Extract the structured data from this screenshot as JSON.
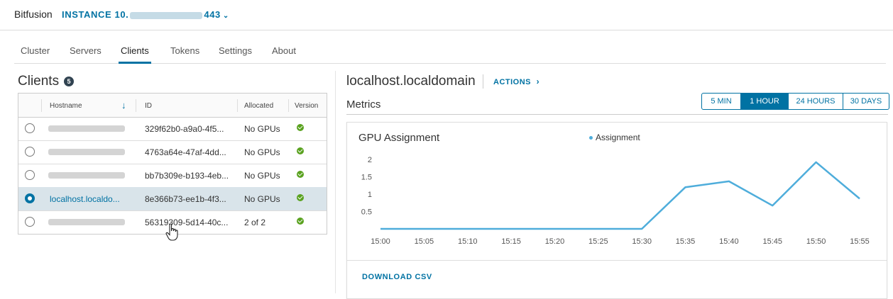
{
  "header": {
    "brand": "Bitfusion",
    "instance_prefix": "INSTANCE 10.",
    "instance_suffix": "443"
  },
  "tabs": [
    "Cluster",
    "Servers",
    "Clients",
    "Tokens",
    "Settings",
    "About"
  ],
  "active_tab": "Clients",
  "clients": {
    "title": "Clients",
    "count": "5",
    "columns": {
      "hostname": "Hostname",
      "id": "ID",
      "allocated": "Allocated",
      "version": "Version"
    },
    "rows": [
      {
        "hostname": "",
        "id": "329f62b0-a9a0-4f5...",
        "allocated": "No GPUs",
        "selected": false
      },
      {
        "hostname": "",
        "id": "4763a64e-47af-4dd...",
        "allocated": "No GPUs",
        "selected": false
      },
      {
        "hostname": "",
        "id": "bb7b309e-b193-4eb...",
        "allocated": "No GPUs",
        "selected": false
      },
      {
        "hostname": "localhost.localdo...",
        "id": "8e366b73-ee1b-4f3...",
        "allocated": "No GPUs",
        "selected": true
      },
      {
        "hostname": "",
        "id": "56319309-5d14-40c...",
        "allocated": "2 of 2",
        "selected": false
      }
    ]
  },
  "detail": {
    "title": "localhost.localdomain",
    "actions_label": "ACTIONS",
    "metrics_title": "Metrics",
    "ranges": [
      "5 MIN",
      "1 HOUR",
      "24 HOURS",
      "30 DAYS"
    ],
    "active_range": "1 HOUR",
    "download_label": "DOWNLOAD CSV"
  },
  "chart_data": {
    "type": "line",
    "title": "GPU Assignment",
    "x": [
      "15:00",
      "15:05",
      "15:10",
      "15:15",
      "15:20",
      "15:25",
      "15:30",
      "15:35",
      "15:40",
      "15:45",
      "15:50",
      "15:55"
    ],
    "series": [
      {
        "name": "Assignment",
        "values": [
          0,
          0,
          0,
          0,
          0,
          0,
          0,
          1.2,
          1.37,
          0.67,
          1.92,
          0.87
        ]
      }
    ],
    "yticks": [
      "0.5",
      "1",
      "1.5",
      "2"
    ],
    "ylim": [
      0,
      2
    ],
    "line_color": "#4eaddb",
    "legend_position": "top"
  },
  "colors": {
    "accent": "#0072a3",
    "ok": "#5aa220",
    "series": "#4eaddb"
  }
}
